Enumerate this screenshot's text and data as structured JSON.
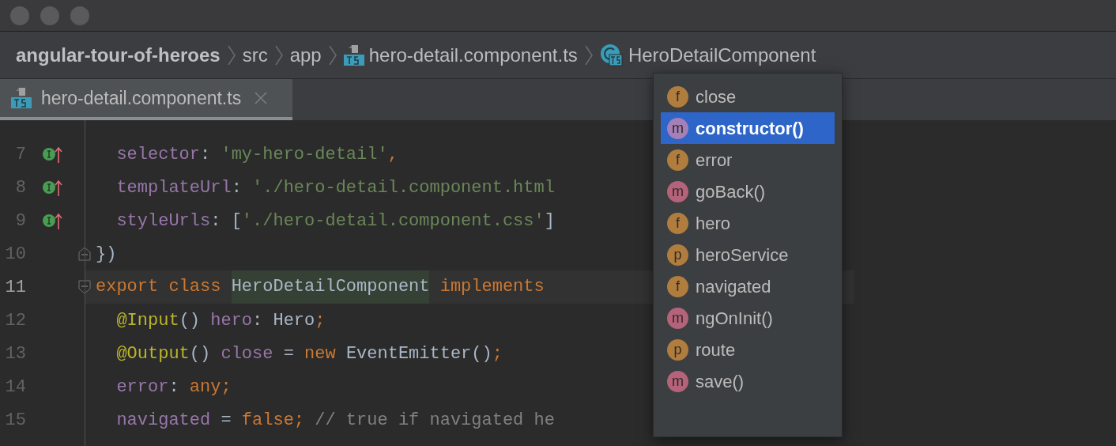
{
  "breadcrumbs": [
    {
      "label": "angular-tour-of-heroes",
      "kind": "project"
    },
    {
      "label": "src",
      "kind": "folder"
    },
    {
      "label": "app",
      "kind": "folder"
    },
    {
      "label": "hero-detail.component.ts",
      "kind": "file"
    },
    {
      "label": "HeroDetailComponent",
      "kind": "class"
    }
  ],
  "tabs": [
    {
      "label": "hero-detail.component.ts",
      "selected": true
    }
  ],
  "editor": {
    "lines": [
      {
        "number": "7",
        "current": false,
        "marker": true,
        "fold_start": false,
        "fold_end": false,
        "tokens": [
          {
            "t": "  selector",
            "kind": "prop"
          },
          {
            "t": ": ",
            "kind": "punct"
          },
          {
            "t": "'my-hero-detail'",
            "kind": "str"
          },
          {
            "t": ",",
            "kind": "kw"
          }
        ]
      },
      {
        "number": "8",
        "current": false,
        "marker": true,
        "fold_start": false,
        "fold_end": false,
        "tokens": [
          {
            "t": "  templateUrl",
            "kind": "prop"
          },
          {
            "t": ": ",
            "kind": "punct"
          },
          {
            "t": "'./hero-detail.component.html",
            "kind": "str"
          }
        ]
      },
      {
        "number": "9",
        "current": false,
        "marker": true,
        "fold_start": false,
        "fold_end": false,
        "tokens": [
          {
            "t": "  styleUrls",
            "kind": "prop"
          },
          {
            "t": ": [",
            "kind": "punct"
          },
          {
            "t": "'./hero-detail.component.css'",
            "kind": "str"
          },
          {
            "t": "]",
            "kind": "punct"
          }
        ]
      },
      {
        "number": "10",
        "current": false,
        "marker": false,
        "fold_start": false,
        "fold_end": true,
        "tokens": [
          {
            "t": "})",
            "kind": "punct"
          }
        ]
      },
      {
        "number": "11",
        "current": true,
        "marker": false,
        "fold_start": true,
        "fold_end": false,
        "tokens": [
          {
            "t": "export class ",
            "kind": "kw"
          },
          {
            "t": "HeroDetailComponent",
            "kind": "highlight"
          },
          {
            "t": " implements",
            "kind": "kw"
          }
        ]
      },
      {
        "number": "12",
        "current": false,
        "marker": false,
        "fold_start": false,
        "fold_end": false,
        "tokens": [
          {
            "t": "  @Input",
            "kind": "dec"
          },
          {
            "t": "() ",
            "kind": "punct"
          },
          {
            "t": "hero",
            "kind": "prop"
          },
          {
            "t": ": Hero",
            "kind": "punct"
          },
          {
            "t": ";",
            "kind": "kw"
          }
        ]
      },
      {
        "number": "13",
        "current": false,
        "marker": false,
        "fold_start": false,
        "fold_end": false,
        "tokens": [
          {
            "t": "  @Output",
            "kind": "dec"
          },
          {
            "t": "() ",
            "kind": "punct"
          },
          {
            "t": "close",
            "kind": "prop"
          },
          {
            "t": " = ",
            "kind": "punct"
          },
          {
            "t": "new ",
            "kind": "kw"
          },
          {
            "t": "EventEmitter()",
            "kind": "punct"
          },
          {
            "t": ";",
            "kind": "kw"
          }
        ]
      },
      {
        "number": "14",
        "current": false,
        "marker": false,
        "fold_start": false,
        "fold_end": false,
        "tokens": [
          {
            "t": "  error",
            "kind": "prop"
          },
          {
            "t": ": ",
            "kind": "punct"
          },
          {
            "t": "any;",
            "kind": "kw"
          }
        ]
      },
      {
        "number": "15",
        "current": false,
        "marker": false,
        "fold_start": false,
        "fold_end": false,
        "tokens": [
          {
            "t": "  navigated",
            "kind": "prop"
          },
          {
            "t": " = ",
            "kind": "punct"
          },
          {
            "t": "false;",
            "kind": "kw"
          },
          {
            "t": " // true if navigated he",
            "kind": "comment"
          }
        ]
      }
    ]
  },
  "popup": {
    "items": [
      {
        "badge": "f",
        "label": "close",
        "color": "#b07d3f",
        "selected": false
      },
      {
        "badge": "m",
        "label": "constructor()",
        "color": "#a57fb8",
        "selected": true
      },
      {
        "badge": "f",
        "label": "error",
        "color": "#b07d3f",
        "selected": false
      },
      {
        "badge": "m",
        "label": "goBack()",
        "color": "#b4637a",
        "selected": false
      },
      {
        "badge": "f",
        "label": "hero",
        "color": "#b07d3f",
        "selected": false
      },
      {
        "badge": "p",
        "label": "heroService",
        "color": "#b07d3f",
        "selected": false
      },
      {
        "badge": "f",
        "label": "navigated",
        "color": "#b07d3f",
        "selected": false
      },
      {
        "badge": "m",
        "label": "ngOnInit()",
        "color": "#b4637a",
        "selected": false
      },
      {
        "badge": "p",
        "label": "route",
        "color": "#b07d3f",
        "selected": false
      },
      {
        "badge": "m",
        "label": "save()",
        "color": "#b4637a",
        "selected": false
      }
    ]
  }
}
